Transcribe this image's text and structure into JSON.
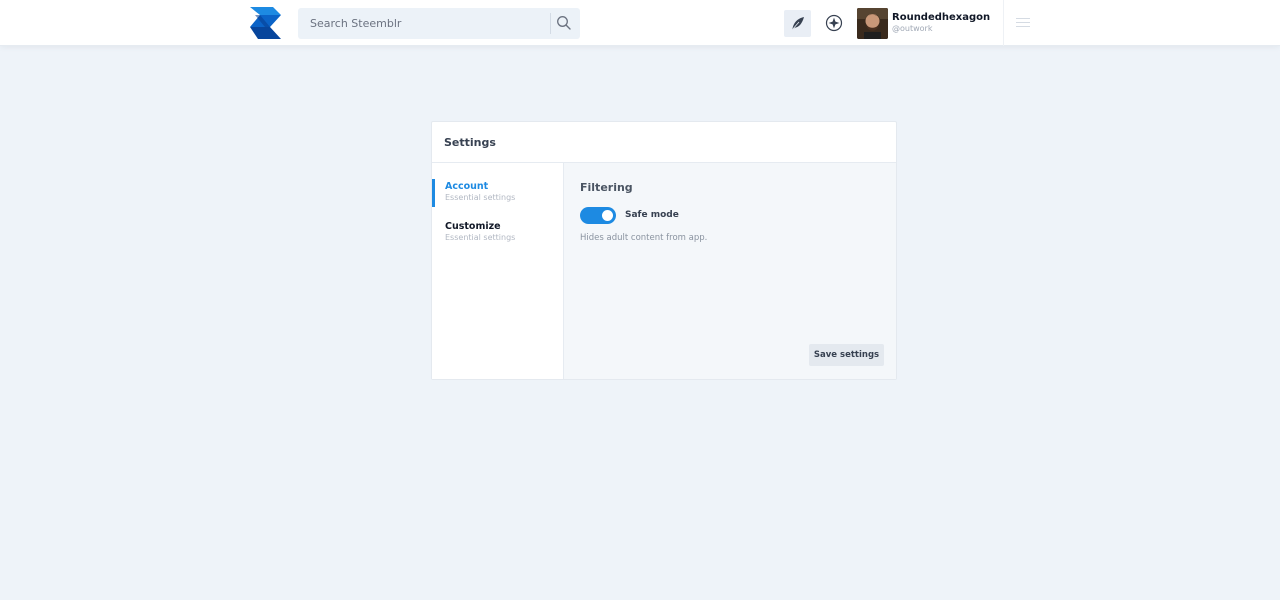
{
  "app": {
    "name": "Steemblr",
    "logo_icon": "steemblr-logo-icon",
    "brand_color": "#1d8ae2"
  },
  "header": {
    "search": {
      "placeholder": "Search Steemblr",
      "value": "",
      "icon": "search-icon"
    },
    "write_icon": "quill-icon",
    "explore_icon": "compass-icon",
    "menu_icon": "hamburger-menu-icon",
    "user": {
      "name": "Roundedhexagon",
      "handle": "@outwork",
      "avatar_icon": "user-avatar"
    }
  },
  "settings": {
    "title": "Settings",
    "sidebar": {
      "items": [
        {
          "label": "Account",
          "subtitle": "Essential settings",
          "active": true
        },
        {
          "label": "Customize",
          "subtitle": "Essential settings",
          "active": false
        }
      ]
    },
    "filtering": {
      "title": "Filtering",
      "safe_mode": {
        "label": "Safe mode",
        "enabled": true,
        "description": "Hides adult content from app."
      }
    },
    "save_label": "Save settings"
  }
}
